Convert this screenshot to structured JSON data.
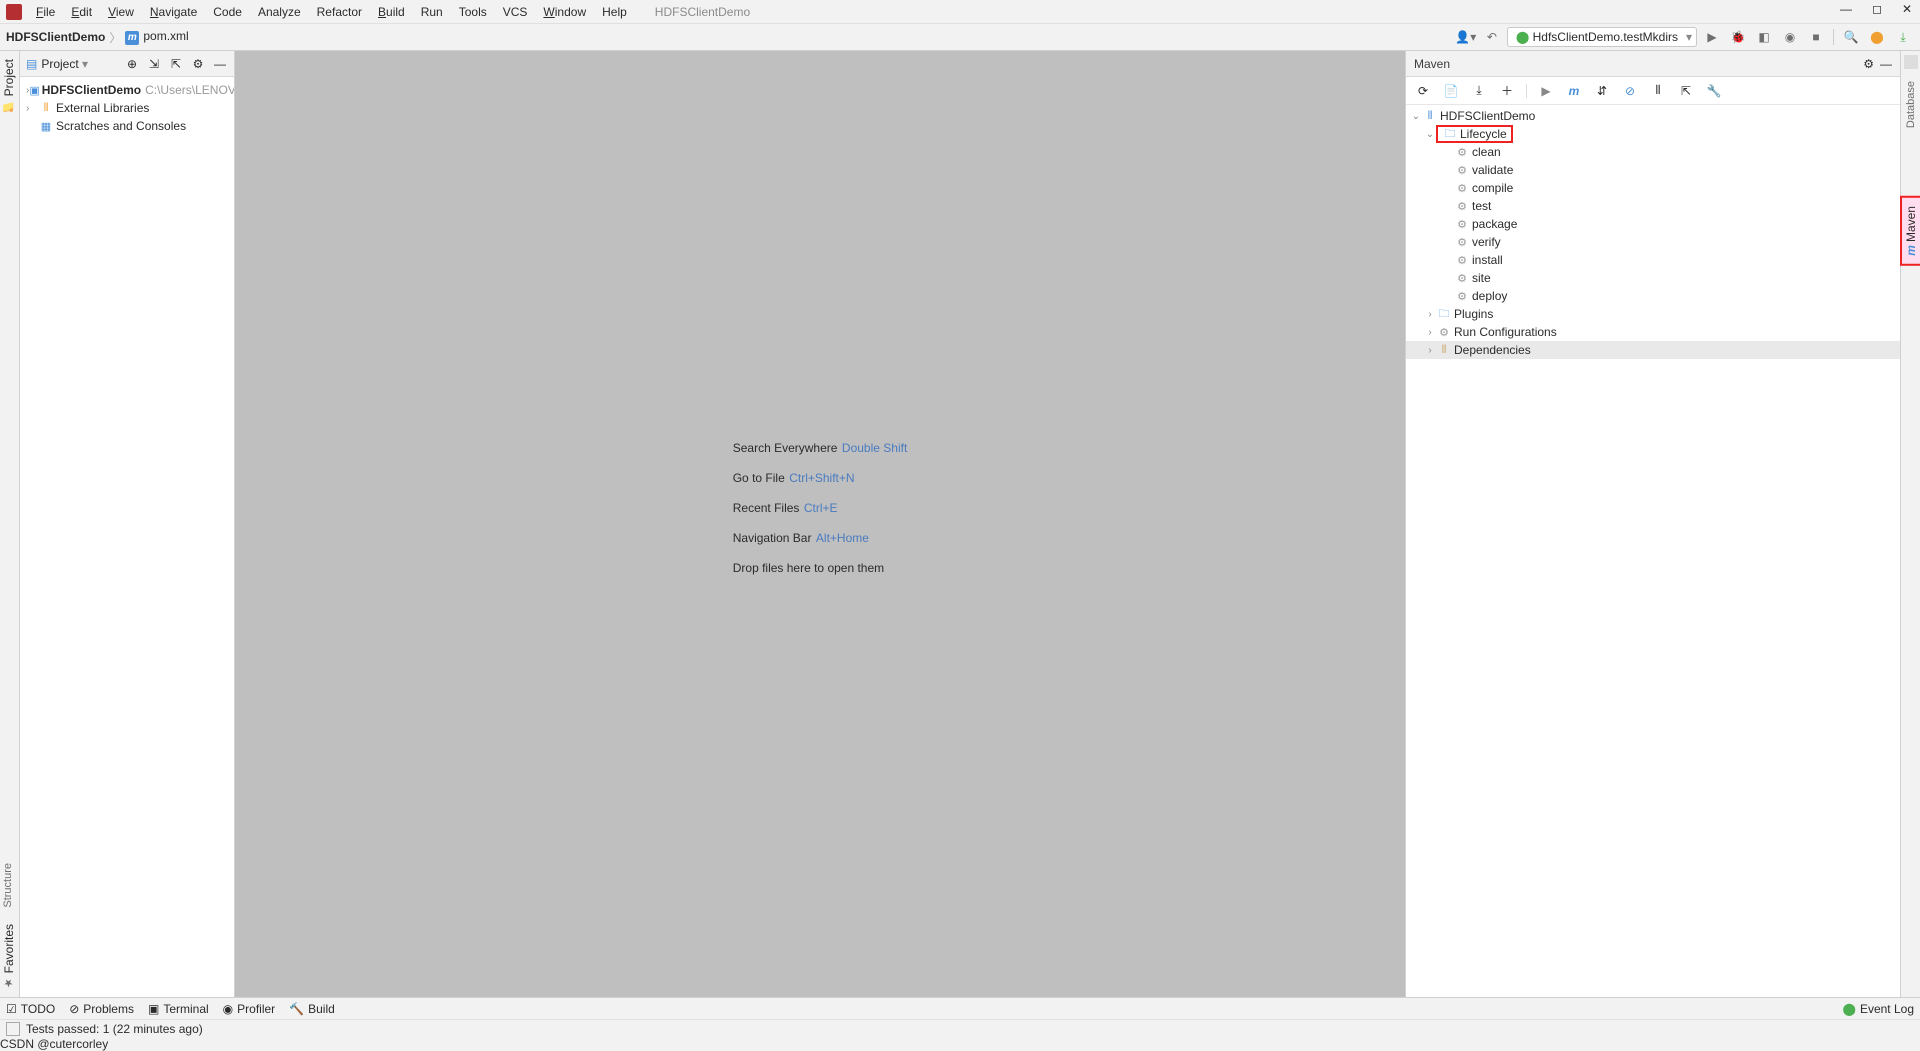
{
  "menu": {
    "items": [
      "File",
      "Edit",
      "View",
      "Navigate",
      "Code",
      "Analyze",
      "Refactor",
      "Build",
      "Run",
      "Tools",
      "VCS",
      "Window",
      "Help"
    ],
    "project": "HDFSClientDemo"
  },
  "breadcrumbs": {
    "root": "HDFSClientDemo",
    "file": "pom.xml"
  },
  "run_config": {
    "label": "HdfsClientDemo.testMkdirs"
  },
  "project": {
    "header": "Project",
    "tree": {
      "root": {
        "name": "HDFSClientDemo",
        "path": "C:\\Users\\LENOVO"
      },
      "libs": "External Libraries",
      "scratch": "Scratches and Consoles"
    }
  },
  "editor_hints": {
    "l1": {
      "text": "Search Everywhere",
      "kb": "Double Shift"
    },
    "l2": {
      "text": "Go to File",
      "kb": "Ctrl+Shift+N"
    },
    "l3": {
      "text": "Recent Files",
      "kb": "Ctrl+E"
    },
    "l4": {
      "text": "Navigation Bar",
      "kb": "Alt+Home"
    },
    "l5": {
      "text": "Drop files here to open them",
      "kb": ""
    }
  },
  "maven": {
    "title": "Maven",
    "project": "HDFSClientDemo",
    "lifecycle_label": "Lifecycle",
    "lifecycle": [
      "clean",
      "validate",
      "compile",
      "test",
      "package",
      "verify",
      "install",
      "site",
      "deploy"
    ],
    "plugins": "Plugins",
    "runconfigs": "Run Configurations",
    "deps": "Dependencies"
  },
  "gutters": {
    "left_top": "Project",
    "left_bot1": "Structure",
    "left_bot2": "Favorites",
    "right_top": "Database",
    "right_maven": "Maven"
  },
  "bottom": {
    "todo": "TODO",
    "problems": "Problems",
    "terminal": "Terminal",
    "profiler": "Profiler",
    "build": "Build",
    "eventlog": "Event Log"
  },
  "status": {
    "text": "Tests passed: 1 (22 minutes ago)"
  },
  "watermark": "CSDN @cutercorley"
}
